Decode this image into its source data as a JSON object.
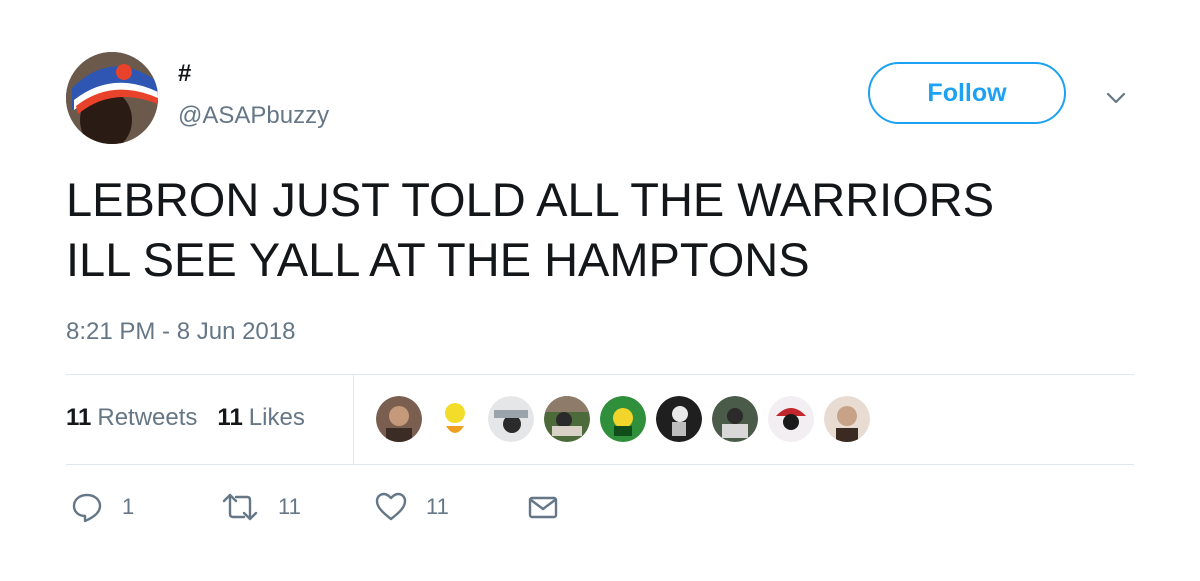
{
  "tweet": {
    "user": {
      "name": "#",
      "handle": "@ASAPbuzzy"
    },
    "follow_label": "Follow",
    "text_lines": [
      "LEBRON JUST TOLD ALL THE WARRIORS",
      "ILL SEE YALL AT THE HAMPTONS"
    ],
    "timestamp": "8:21 PM - 8 Jun 2018",
    "stats": {
      "retweets_count": "11",
      "retweets_label": "Retweets",
      "likes_count": "11",
      "likes_label": "Likes"
    },
    "actions": {
      "reply_count": "1",
      "retweet_count": "11",
      "like_count": "11"
    }
  },
  "colors": {
    "accent": "#1da1f2",
    "text": "#14171a",
    "muted": "#657786",
    "divider": "#e1e8ed"
  }
}
